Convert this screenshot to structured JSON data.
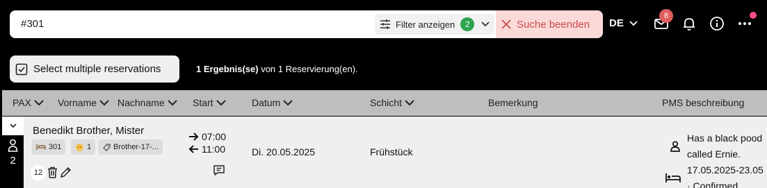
{
  "search": {
    "value": "#301",
    "filter_label": "Filter anzeigen",
    "filter_count": "2",
    "end_label": "Suche beenden"
  },
  "topbar": {
    "language": "DE",
    "mail_badge": "8"
  },
  "toolbar": {
    "multi_select_label": "Select multiple reservations",
    "result_bold": "1 Ergebnis(se)",
    "result_rest": " von 1 Reservierung(en)."
  },
  "columns": {
    "pax": "PAX",
    "vorname": "Vorname",
    "nachname": "Nachname",
    "start": "Start",
    "datum": "Datum",
    "schicht": "Schicht",
    "bemerkung": "Bemerkung",
    "pms": "PMS beschreibung"
  },
  "reservation": {
    "pax": "2",
    "name": "Benedikt Brother, Mister",
    "room": "301",
    "children": "1",
    "tag": "Brother-17-...",
    "count": "12",
    "start_in": "07:00",
    "start_out": "11:00",
    "date": "Di. 20.05.2025",
    "shift": "Frühstück",
    "pms_lines": [
      "Has a black pood",
      "called Ernie.",
      "17.05.2025-23.05",
      "· Confirmed"
    ]
  },
  "colors": {
    "accent_green": "#2ea44f",
    "danger": "#c94a4a",
    "danger_bg": "#fbd9d9",
    "badge_red": "#e05d5d",
    "dot_pink": "#ff4d8d"
  }
}
